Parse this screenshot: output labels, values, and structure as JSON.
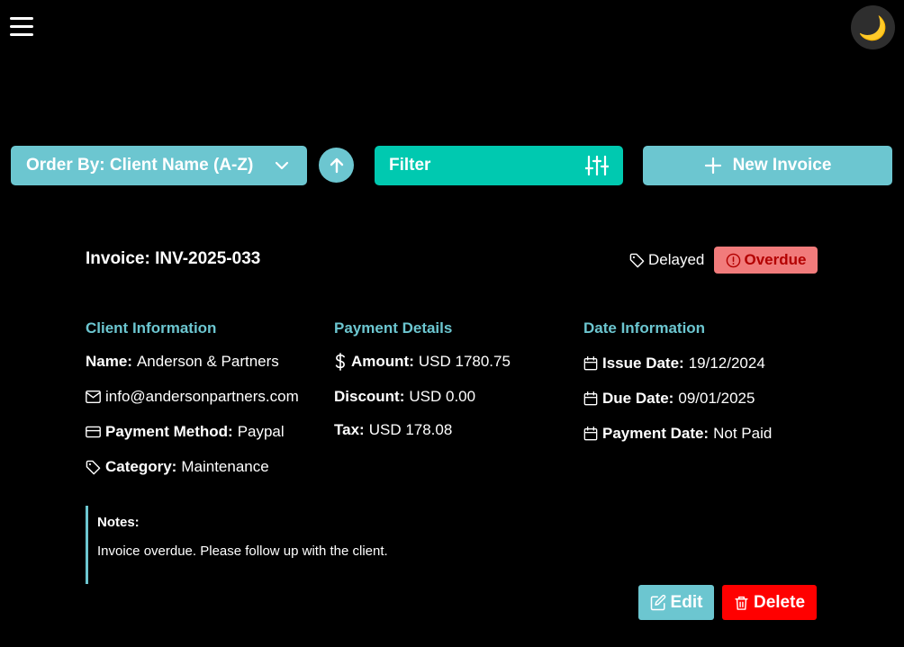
{
  "topbar": {
    "menu_icon": "hamburger-icon",
    "theme_icon": "moon-icon",
    "theme_glyph": "🌙"
  },
  "toolbar": {
    "order_label": "Order By: Client Name (A-Z)",
    "order_icon": "chevron-down-icon",
    "sort_icon": "arrow-up-icon",
    "filter_label": "Filter",
    "filter_icon": "sliders-icon",
    "new_label": "New Invoice",
    "new_icon": "plus-icon"
  },
  "invoice": {
    "title": "Invoice: INV-2025-033",
    "status_tag": "Delayed",
    "status_badge": "Overdue",
    "client": {
      "heading": "Client Information",
      "name_label": "Name:",
      "name": "Anderson & Partners",
      "email": "info@andersonpartners.com",
      "payment_method_label": "Payment Method:",
      "payment_method": "Paypal",
      "category_label": "Category:",
      "category": "Maintenance"
    },
    "payment": {
      "heading": "Payment Details",
      "amount_label": "Amount:",
      "amount": "USD 1780.75",
      "discount_label": "Discount:",
      "discount": "USD 0.00",
      "tax_label": "Tax:",
      "tax": "USD 178.08"
    },
    "dates": {
      "heading": "Date Information",
      "issue_label": "Issue Date:",
      "issue": "19/12/2024",
      "due_label": "Due Date:",
      "due": "09/01/2025",
      "payment_label": "Payment Date:",
      "payment": "Not Paid"
    },
    "notes": {
      "title": "Notes:",
      "text": "Invoice overdue. Please follow up with the client."
    },
    "actions": {
      "edit_label": "Edit",
      "delete_label": "Delete"
    }
  },
  "colors": {
    "accent": "#6cc6d0",
    "filter": "#00c9b0",
    "overdue_bg": "#f17b7b",
    "overdue_text": "#b30000",
    "danger": "#ff0000",
    "background": "#000000"
  }
}
